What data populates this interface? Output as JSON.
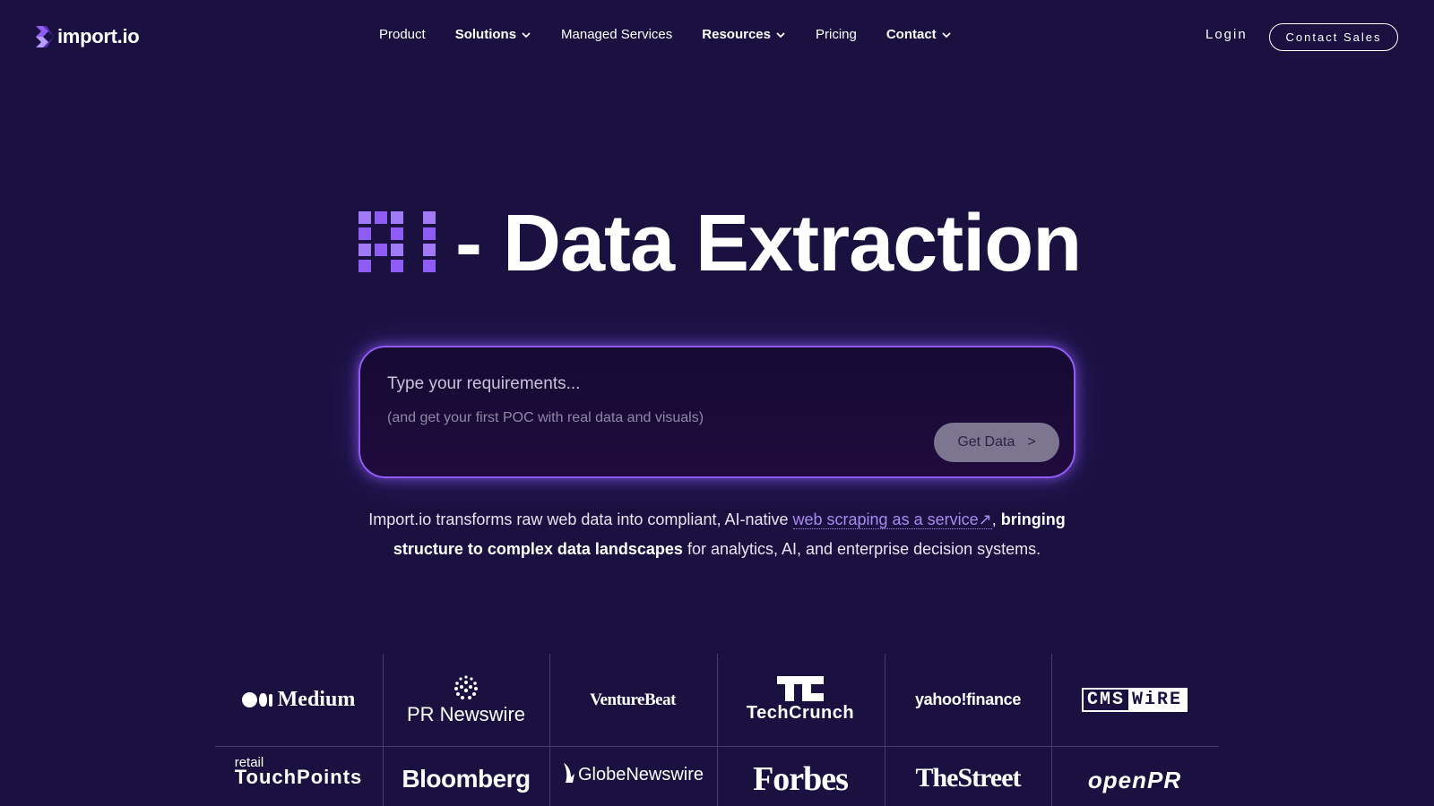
{
  "brand": {
    "name": "import.io",
    "accent": "#8f5cf5",
    "background": "#1a1140"
  },
  "nav": {
    "items": [
      {
        "label": "Product",
        "dropdown": false
      },
      {
        "label": "Solutions",
        "dropdown": true
      },
      {
        "label": "Managed Services",
        "dropdown": false
      },
      {
        "label": "Resources",
        "dropdown": true
      },
      {
        "label": "Pricing",
        "dropdown": false
      },
      {
        "label": "Contact",
        "dropdown": true
      }
    ],
    "login_label": "Login",
    "contact_sales_label": "Contact Sales"
  },
  "hero": {
    "pixel_prefix": "AI",
    "title": "- Data Extraction"
  },
  "prompt": {
    "placeholder": "Type your requirements...",
    "subtext": "(and get your first POC with real data and visuals)",
    "button_label": "Get Data",
    "button_arrow": ">"
  },
  "description": {
    "part1": "Import.io transforms raw web data into compliant, AI-native ",
    "link": "web scraping as a service↗",
    "part2": ", ",
    "bold1": "bringing structure to complex data landscapes",
    "part3": " for analytics, AI, and enterprise decision systems."
  },
  "logos": {
    "row1": [
      {
        "name": "Medium",
        "icon": "medium-logo"
      },
      {
        "name": "PR Newswire",
        "icon": "pr-newswire-logo"
      },
      {
        "name": "VentureBeat",
        "icon": "venturebeat-logo"
      },
      {
        "name": "TechCrunch",
        "icon": "techcrunch-logo"
      },
      {
        "name": "yahoo!finance",
        "icon": "yahoo-finance-logo"
      },
      {
        "cms": "CMS",
        "wire": "WiRE",
        "icon": "cmswire-logo"
      }
    ],
    "row2": [
      {
        "small": "retail",
        "big": "TouchPoints",
        "icon": "retail-touchpoints-logo"
      },
      {
        "name": "Bloomberg",
        "icon": "bloomberg-logo"
      },
      {
        "name": "GlobeNewswire",
        "icon": "globenewswire-logo"
      },
      {
        "name": "Forbes",
        "icon": "forbes-logo"
      },
      {
        "name": "TheStreet",
        "icon": "thestreet-logo"
      },
      {
        "name": "openPR",
        "icon": "openpr-logo"
      }
    ]
  }
}
